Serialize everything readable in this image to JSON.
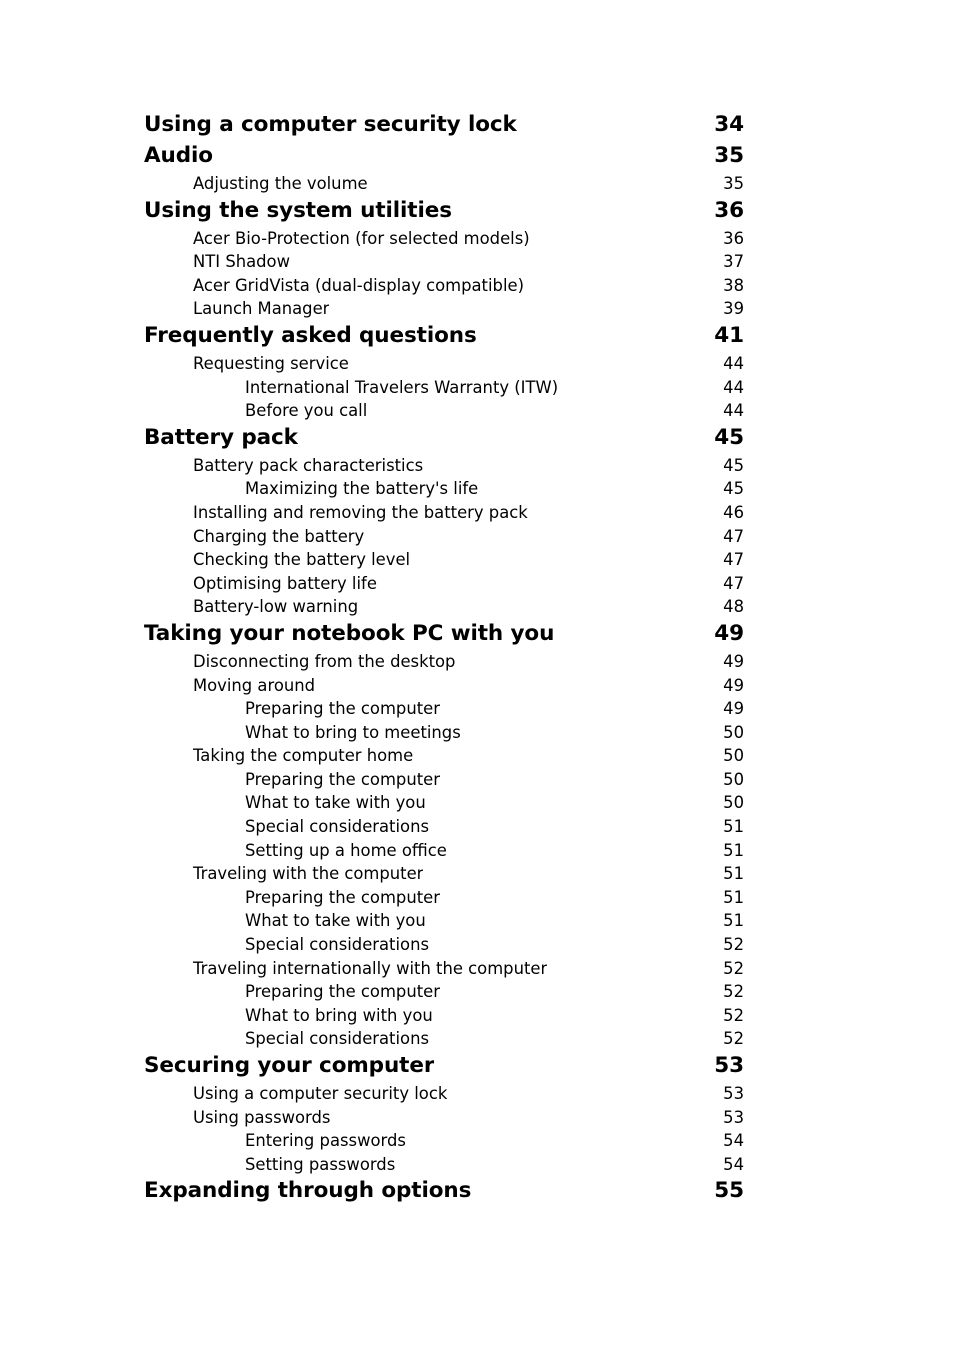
{
  "document": {
    "type": "table-of-contents",
    "text_color": "#000000",
    "background_color": "#ffffff"
  },
  "toc": {
    "entries": [
      {
        "level": 0,
        "label": "Using a computer security lock",
        "page": "34"
      },
      {
        "level": 0,
        "label": "Audio",
        "page": "35"
      },
      {
        "level": 1,
        "label": "Adjusting the volume",
        "page": "35"
      },
      {
        "level": 0,
        "label": "Using the system utilities",
        "page": "36"
      },
      {
        "level": 1,
        "label": "Acer Bio-Protection (for selected models)",
        "page": "36"
      },
      {
        "level": 1,
        "label": "NTI Shadow",
        "page": "37"
      },
      {
        "level": 1,
        "label": "Acer GridVista (dual-display compatible)",
        "page": "38"
      },
      {
        "level": 1,
        "label": "Launch Manager",
        "page": "39"
      },
      {
        "level": 0,
        "label": "Frequently asked questions",
        "page": "41"
      },
      {
        "level": 1,
        "label": "Requesting service",
        "page": "44"
      },
      {
        "level": 2,
        "label": "International Travelers Warranty (ITW)",
        "page": "44"
      },
      {
        "level": 2,
        "label": "Before you call",
        "page": "44"
      },
      {
        "level": 0,
        "label": "Battery pack",
        "page": "45"
      },
      {
        "level": 1,
        "label": "Battery pack characteristics",
        "page": "45"
      },
      {
        "level": 2,
        "label": "Maximizing the battery's life",
        "page": "45"
      },
      {
        "level": 1,
        "label": "Installing and removing the battery pack",
        "page": "46"
      },
      {
        "level": 1,
        "label": "Charging the battery",
        "page": "47"
      },
      {
        "level": 1,
        "label": "Checking the battery level",
        "page": "47"
      },
      {
        "level": 1,
        "label": "Optimising battery life",
        "page": "47"
      },
      {
        "level": 1,
        "label": "Battery-low warning",
        "page": "48"
      },
      {
        "level": 0,
        "label": "Taking your notebook PC with you",
        "page": "49"
      },
      {
        "level": 1,
        "label": "Disconnecting from the desktop",
        "page": "49"
      },
      {
        "level": 1,
        "label": "Moving around",
        "page": "49"
      },
      {
        "level": 2,
        "label": "Preparing the computer",
        "page": "49"
      },
      {
        "level": 2,
        "label": "What to bring to meetings",
        "page": "50"
      },
      {
        "level": 1,
        "label": "Taking the computer home",
        "page": "50"
      },
      {
        "level": 2,
        "label": "Preparing the computer",
        "page": "50"
      },
      {
        "level": 2,
        "label": "What to take with you",
        "page": "50"
      },
      {
        "level": 2,
        "label": "Special considerations",
        "page": "51"
      },
      {
        "level": 2,
        "label": "Setting up a home office",
        "page": "51"
      },
      {
        "level": 1,
        "label": "Traveling with the computer",
        "page": "51"
      },
      {
        "level": 2,
        "label": "Preparing the computer",
        "page": "51"
      },
      {
        "level": 2,
        "label": "What to take with you",
        "page": "51"
      },
      {
        "level": 2,
        "label": "Special considerations",
        "page": "52"
      },
      {
        "level": 1,
        "label": "Traveling internationally with the computer",
        "page": "52"
      },
      {
        "level": 2,
        "label": "Preparing the computer",
        "page": "52"
      },
      {
        "level": 2,
        "label": "What to bring with you",
        "page": "52"
      },
      {
        "level": 2,
        "label": "Special considerations",
        "page": "52"
      },
      {
        "level": 0,
        "label": "Securing your computer",
        "page": "53"
      },
      {
        "level": 1,
        "label": "Using a computer security lock",
        "page": "53"
      },
      {
        "level": 1,
        "label": "Using passwords",
        "page": "53"
      },
      {
        "level": 2,
        "label": "Entering passwords",
        "page": "54"
      },
      {
        "level": 2,
        "label": "Setting passwords",
        "page": "54"
      },
      {
        "level": 0,
        "label": "Expanding through options",
        "page": "55"
      }
    ]
  }
}
